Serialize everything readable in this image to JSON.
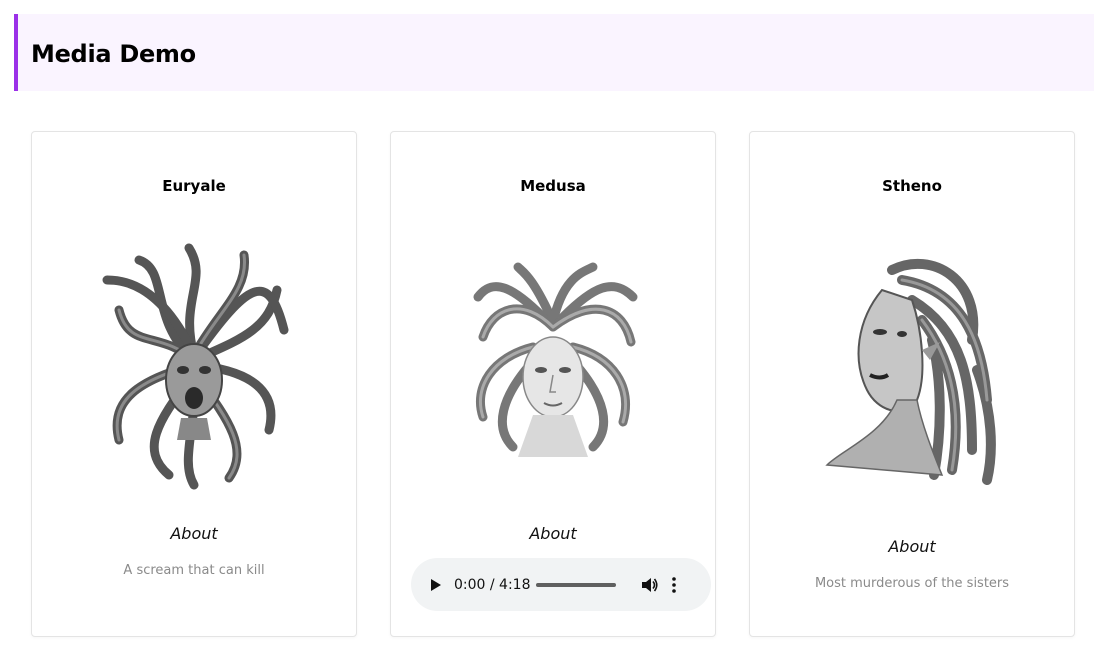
{
  "header": {
    "title": "Media Demo",
    "accent_color": "#9b30e8",
    "background": "#faf4ff"
  },
  "cards": [
    {
      "name": "Euryale",
      "image": "euryale-portrait",
      "about": "About",
      "description": "A scream that can kill"
    },
    {
      "name": "Medusa",
      "image": "medusa-portrait",
      "about": "About",
      "audio": {
        "current_time": "0:00",
        "duration": "4:18",
        "time_display": "0:00 / 4:18",
        "progress": 0
      }
    },
    {
      "name": "Stheno",
      "image": "stheno-portrait",
      "about": "About",
      "description": "Most murderous of the sisters"
    }
  ]
}
